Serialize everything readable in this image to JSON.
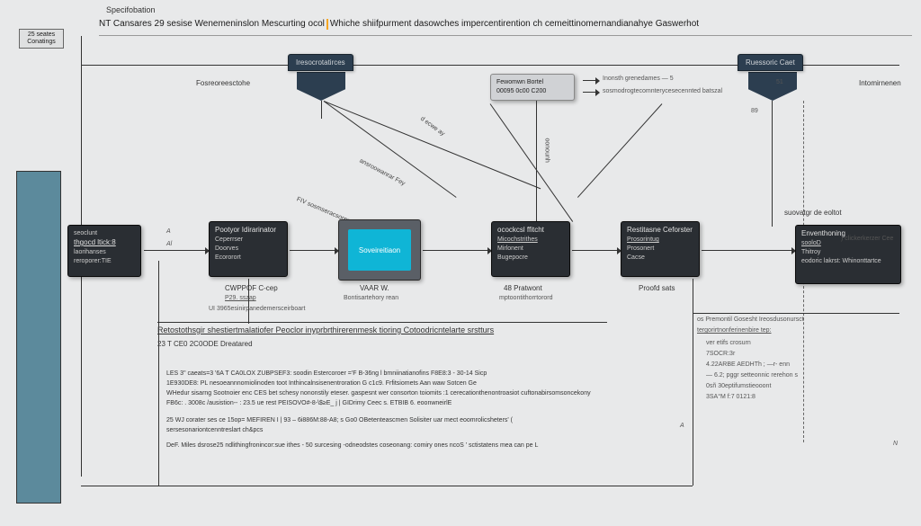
{
  "header": {
    "side_box": "25 seates Conatings",
    "spec": "Specifobation",
    "title_left": "NT Cansares 29 sesise Wenemeninslon Mescurting ocol",
    "title_right": "Whiche shiifpurment dasowches impercentirention ch cemeittinomernandianahye Gaswerhot"
  },
  "top_tabs": {
    "left": "Iresocrotatirces",
    "right": "Ruessoric Caet"
  },
  "top_labels": {
    "fosc": "Fosreoreesctohe",
    "box_mid": "Fewomwn Bortel\n00095 0c00 C200",
    "monali": "Inonsth grenedames —  5",
    "sosmod": "sosmodrogtecomnterycesecennted batszal",
    "num51": "51",
    "num89": "89",
    "intom": "Intomirnenen"
  },
  "diag_labels": {
    "d1": "d ecwe ay",
    "d2": "ansroowanrar Fey",
    "d3": "FIV sosmseracsorery:l",
    "d4": "oonounh"
  },
  "left_box": {
    "l1": "seoclunt",
    "l2": "thgocd ltick:8",
    "l3": "laorihanses",
    "l4": "reroporer:TIE"
  },
  "mid_boxes": {
    "b1": {
      "l1": "Pootyor Idirarinator",
      "l2": "Ceperrser",
      "l3": "Doorves",
      "l4": "Ecororort"
    },
    "screen": "Soveireitiaon",
    "b3": {
      "l1": "ocockcsl ffitcht",
      "l2": "Micochstrithes",
      "l3": "Mirlonent",
      "l4": "Bugepocre"
    },
    "b4": {
      "l1": "Restitasne Ceforster",
      "l2": "Prosorintug",
      "l3": "Prosonert",
      "l4": "Cacse"
    }
  },
  "right_box": {
    "hd": "Enventhoning",
    "l1": "sooloD",
    "l2": "Thitroy",
    "l3": "eodoric lakrst: Whinonttartce",
    "side": ") clickerkerzer Cee"
  },
  "under_labels": {
    "u1a": "CWPPOF C-cep",
    "u1b": "P29. sszap",
    "u1c": "UI 3965esinirpanedemersceirboart",
    "u2a": "VAAR W.",
    "u2b": "Bontisartehory rean",
    "u3a": "48 Pratwont",
    "u3b": "mptoontithorrtorord",
    "u4": "Proofd sats",
    "right_top": "suovatgr de eoltot"
  },
  "section_title": "Retostothsgir shestiertmalatiofer Peoclor inyprbrthirerenmesk tioring Cotoodricntelarte srstturs",
  "section_sub": "23 T CE0 2C0ODE Dreatared",
  "right_list": {
    "r1": "os Premontil Gosesht Ireosdusonursct",
    "r2": "tergorirtnonferinenbire tep:",
    "r3": "ver etifs crosurn",
    "r4": "7SOCR:3r",
    "r5": "4.22ARBE AEDHTh ; —r- enn",
    "r6": "— 6.2; pggr setteonnic rerehon s",
    "r7": "0sñ 30eptifumstieooont",
    "r8": "3SA°M f:7 0121:8"
  },
  "paragraphs": {
    "p1": " LES 3\" caeats=3 '6A T CA0LOX ZUBPSEF3: soodin Estercoroer ='F B-36ng l bmniinatianofins F8E8:3 - 30-14 Sicp",
    "p2": "      1E930DE8: PL  nesoeannnomiolinoden toot Inthincalnsisenentroration G c1c9.           Frfitsiomets Aan waw Sotcen  Ge",
    "p3": "WHedur sisarng Sootnoier enc CES   bet schesy nononstily eteser. gaspesnt wer consorton toiomits :1  cerecationthenontroasiot cuftonabirsomsoncekony",
    "p4": "FB6c: . 3008c /ausistion--  : 23.5  ue rest PEISOVO#-8-\\$≥E_   j | GIDrimy Ceec s.   ETBIB 6. eoonwneirlE",
    "p5": " 25   WJ  corater ses ce 15op= MEFIREN I |  93 – 6i886M:88-A8; s Go0 OBetenteascmen Solisiter uar mect eoomrolicsheters' (",
    "p6": "sersesonariontcenntreslart ch&pcs",
    "p7": "DeF. Miles dsrose25 ndlithingfronincor:sue ithes  - 50 surcesing -odneodstes coseonang: comiry ones ncoS  ' sctistatens mea can pe L"
  },
  "tiny": {
    "a": "A",
    "n": "N",
    "al": "Al"
  }
}
